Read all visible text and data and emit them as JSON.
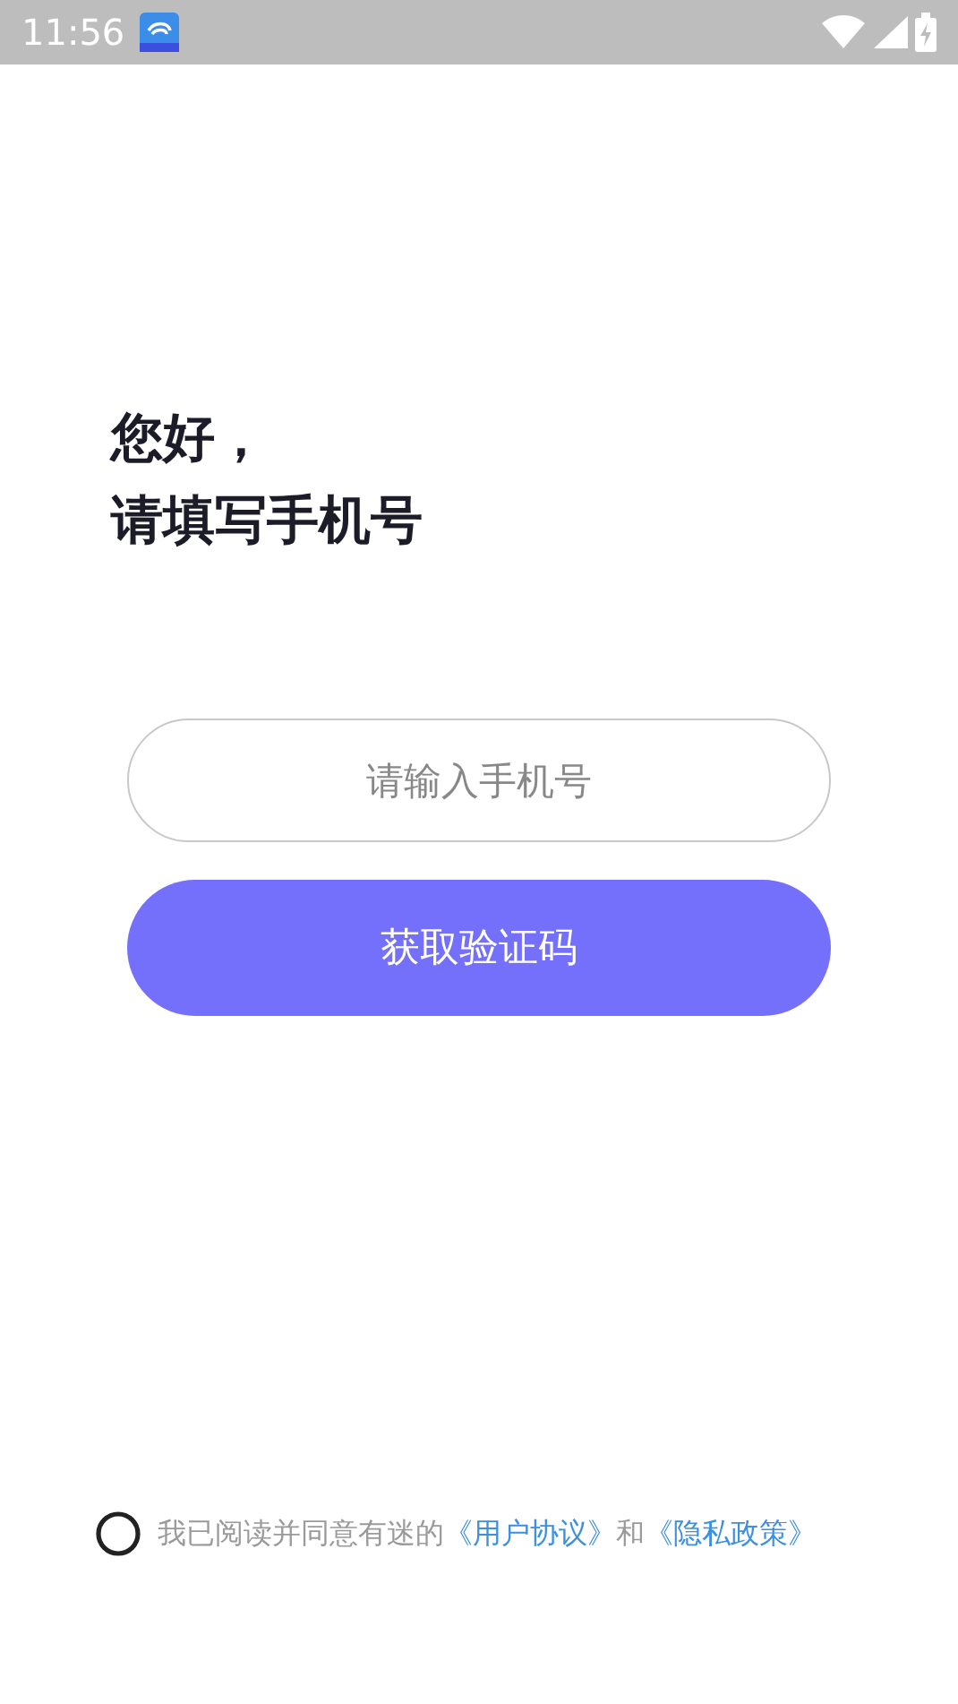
{
  "status_bar": {
    "time": "11:56"
  },
  "greeting": [
    "您好，",
    "请填写手机号"
  ],
  "phone_field": {
    "placeholder": "请输入手机号"
  },
  "submit_button": {
    "label": "获取验证码"
  },
  "agreement": {
    "checked": false,
    "parts": [
      {
        "kind": "text",
        "text": "我已阅读并同意有迷的"
      },
      {
        "kind": "link",
        "text": "《用户协议》"
      },
      {
        "kind": "text",
        "text": "和"
      },
      {
        "kind": "link",
        "text": "《隐私政策》"
      }
    ]
  }
}
